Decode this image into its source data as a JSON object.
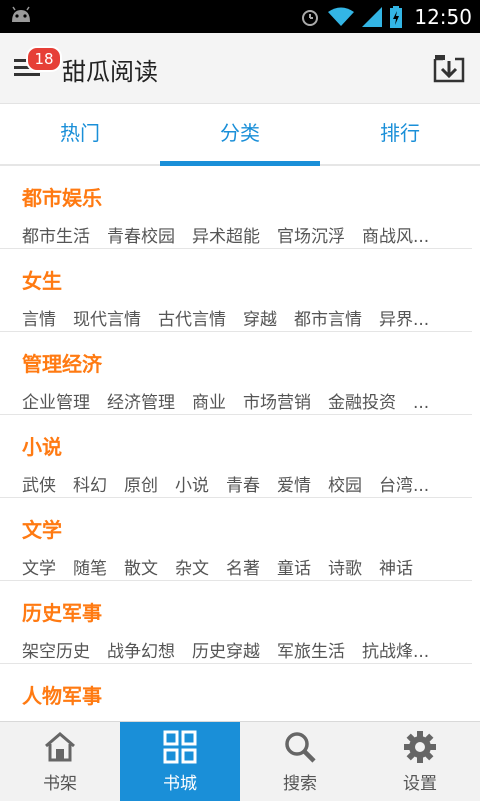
{
  "status_bar": {
    "time": "12:50"
  },
  "header": {
    "title": "甜瓜阅读",
    "notification_count": "18"
  },
  "tabs": [
    {
      "label": "热门"
    },
    {
      "label": "分类"
    },
    {
      "label": "排行"
    }
  ],
  "categories": [
    {
      "title": "都市娱乐",
      "tags": "都市生活　青春校园　异术超能　官场沉浮　商战风..."
    },
    {
      "title": "女生",
      "tags": "言情　现代言情　古代言情　穿越　都市言情　异界..."
    },
    {
      "title": "管理经济",
      "tags": "企业管理　经济管理　商业　市场营销　金融投资　..."
    },
    {
      "title": "小说",
      "tags": "武侠　科幻　原创　小说　青春　爱情　校园　台湾..."
    },
    {
      "title": "文学",
      "tags": "文学　随笔　散文　杂文　名著　童话　诗歌　神话"
    },
    {
      "title": "历史军事",
      "tags": "架空历史　战争幻想　历史穿越　军旅生活　抗战烽..."
    },
    {
      "title": "人物军事",
      "tags": ""
    }
  ],
  "bottom_nav": [
    {
      "label": "书架",
      "icon": "home-icon"
    },
    {
      "label": "书城",
      "icon": "grid-icon"
    },
    {
      "label": "搜索",
      "icon": "search-icon"
    },
    {
      "label": "设置",
      "icon": "gear-icon"
    }
  ],
  "colors": {
    "accent": "#1a8fd8",
    "category_title": "#ff7a12",
    "badge": "#e63f37"
  }
}
